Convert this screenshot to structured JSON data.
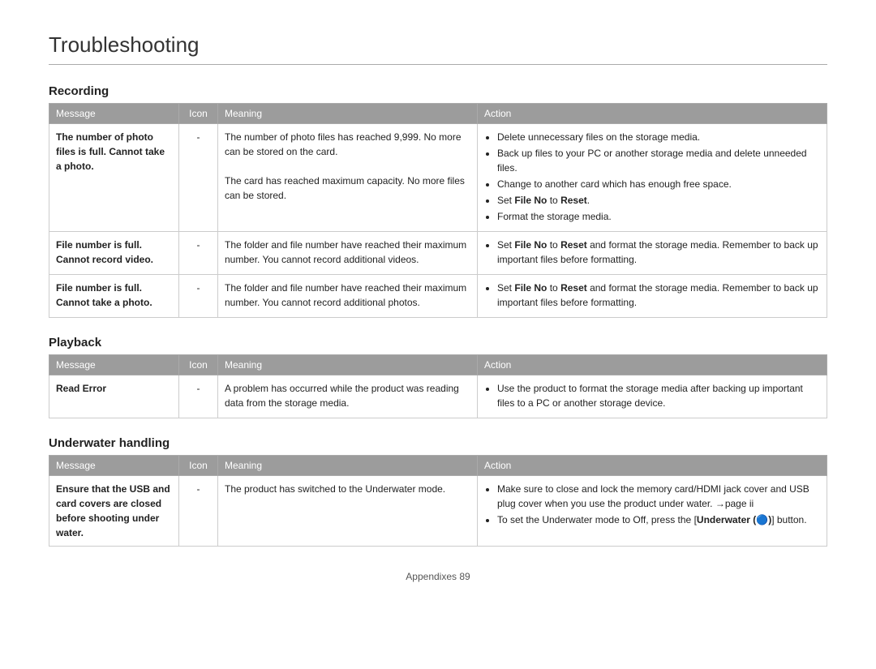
{
  "page": {
    "title": "Troubleshooting",
    "footer": "Appendixes  89"
  },
  "sections": [
    {
      "id": "recording",
      "title": "Recording",
      "columns": [
        "Message",
        "Icon",
        "Meaning",
        "Action"
      ],
      "rows": [
        {
          "message": "The number of photo files is full. Cannot take a photo.",
          "message_bold": true,
          "icon": "-",
          "meaning": "The number of photo files has reached 9,999. No more can be stored on the card.\nThe card has reached maximum capacity. No more files can be stored.",
          "action_items": [
            "Delete unnecessary files on the storage media.",
            "Back up files to your PC or another storage media and delete unneeded files.",
            "Change to another card which has enough free space.",
            "Set File No to Reset.",
            "Format the storage media."
          ],
          "action_bold_parts": [
            [
              "File No",
              "Reset"
            ]
          ]
        },
        {
          "message": "File number is full. Cannot record video.",
          "message_bold": true,
          "icon": "-",
          "meaning": "The folder and file number have reached their maximum number. You cannot record additional videos.",
          "action_items": [
            "Set File No to Reset and format the storage media. Remember to back up important files before formatting."
          ],
          "action_bold_parts": [
            [
              "File No",
              "Reset"
            ]
          ]
        },
        {
          "message": "File number is full. Cannot take a photo.",
          "message_bold": true,
          "icon": "-",
          "meaning": "The folder and file number have reached their maximum number. You cannot record additional photos.",
          "action_items": [
            "Set File No to Reset and format the storage media. Remember to back up important files before formatting."
          ],
          "action_bold_parts": [
            [
              "File No",
              "Reset"
            ]
          ]
        }
      ]
    },
    {
      "id": "playback",
      "title": "Playback",
      "columns": [
        "Message",
        "Icon",
        "Meaning",
        "Action"
      ],
      "rows": [
        {
          "message": "Read Error",
          "message_bold": true,
          "icon": "-",
          "meaning": "A problem has occurred while the product was reading data from the storage media.",
          "action_items": [
            "Use the product to format the storage media after backing up important files to a PC or another storage device."
          ],
          "action_bold_parts": []
        }
      ]
    },
    {
      "id": "underwater",
      "title": "Underwater handling",
      "columns": [
        "Message",
        "Icon",
        "Meaning",
        "Action"
      ],
      "rows": [
        {
          "message": "Ensure that the USB and card covers are closed before shooting under water.",
          "message_bold": true,
          "icon": "-",
          "meaning": "The product has switched to the Underwater mode.",
          "action_items": [
            "Make sure to close and lock the memory card/HDMI jack cover and USB plug cover when you use the product under water. →page ii",
            "To set the Underwater mode to Off, press the [Underwater (🔵)] button."
          ],
          "action_bold_parts": [
            [
              "Underwater"
            ]
          ]
        }
      ]
    }
  ]
}
